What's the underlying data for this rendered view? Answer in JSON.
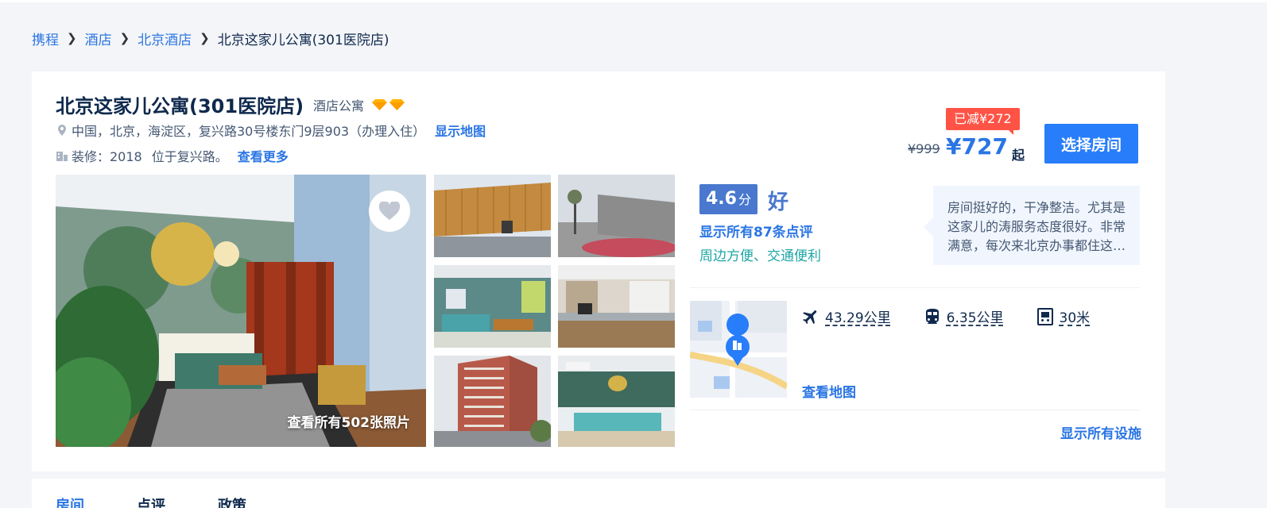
{
  "breadcrumb": {
    "items": [
      "携程",
      "酒店",
      "北京酒店"
    ],
    "current": "北京这家儿公寓(301医院店)"
  },
  "hotel": {
    "name": "北京这家儿公寓(301医院店)",
    "type": "酒店公寓",
    "address": "中国，北京，海淀区，复兴路30号楼东门9层903（办理入住）",
    "show_map": "显示地图",
    "renovation": "装修：2018",
    "location_desc": "位于复兴路。",
    "see_more": "查看更多"
  },
  "price": {
    "discount": "已减¥272",
    "original": "¥999",
    "current": "¥727",
    "from": "起",
    "choose_room": "选择房间"
  },
  "photos": {
    "view_all": "查看所有502张照片"
  },
  "rating": {
    "score": "4.6",
    "unit": "分",
    "word": "好",
    "reviews_link": "显示所有87条点评",
    "tag": "周边方便、交通便利",
    "review_excerpt": "房间挺好的，干净整洁。尤其是这家儿的涛服务态度很好。非常满意，每次来北京办事都住这里。"
  },
  "distances": {
    "airport": "43.29公里",
    "train": "6.35公里",
    "metro": "30米"
  },
  "map_link": "查看地图",
  "facilities_link": "显示所有设施",
  "tabs": [
    "房间",
    "点评",
    "政策"
  ],
  "colors": {
    "accent": "#2a75e4",
    "score_bg": "#4978ce",
    "discount_bg": "#ff5346",
    "tag_green": "#1fa5a5"
  }
}
